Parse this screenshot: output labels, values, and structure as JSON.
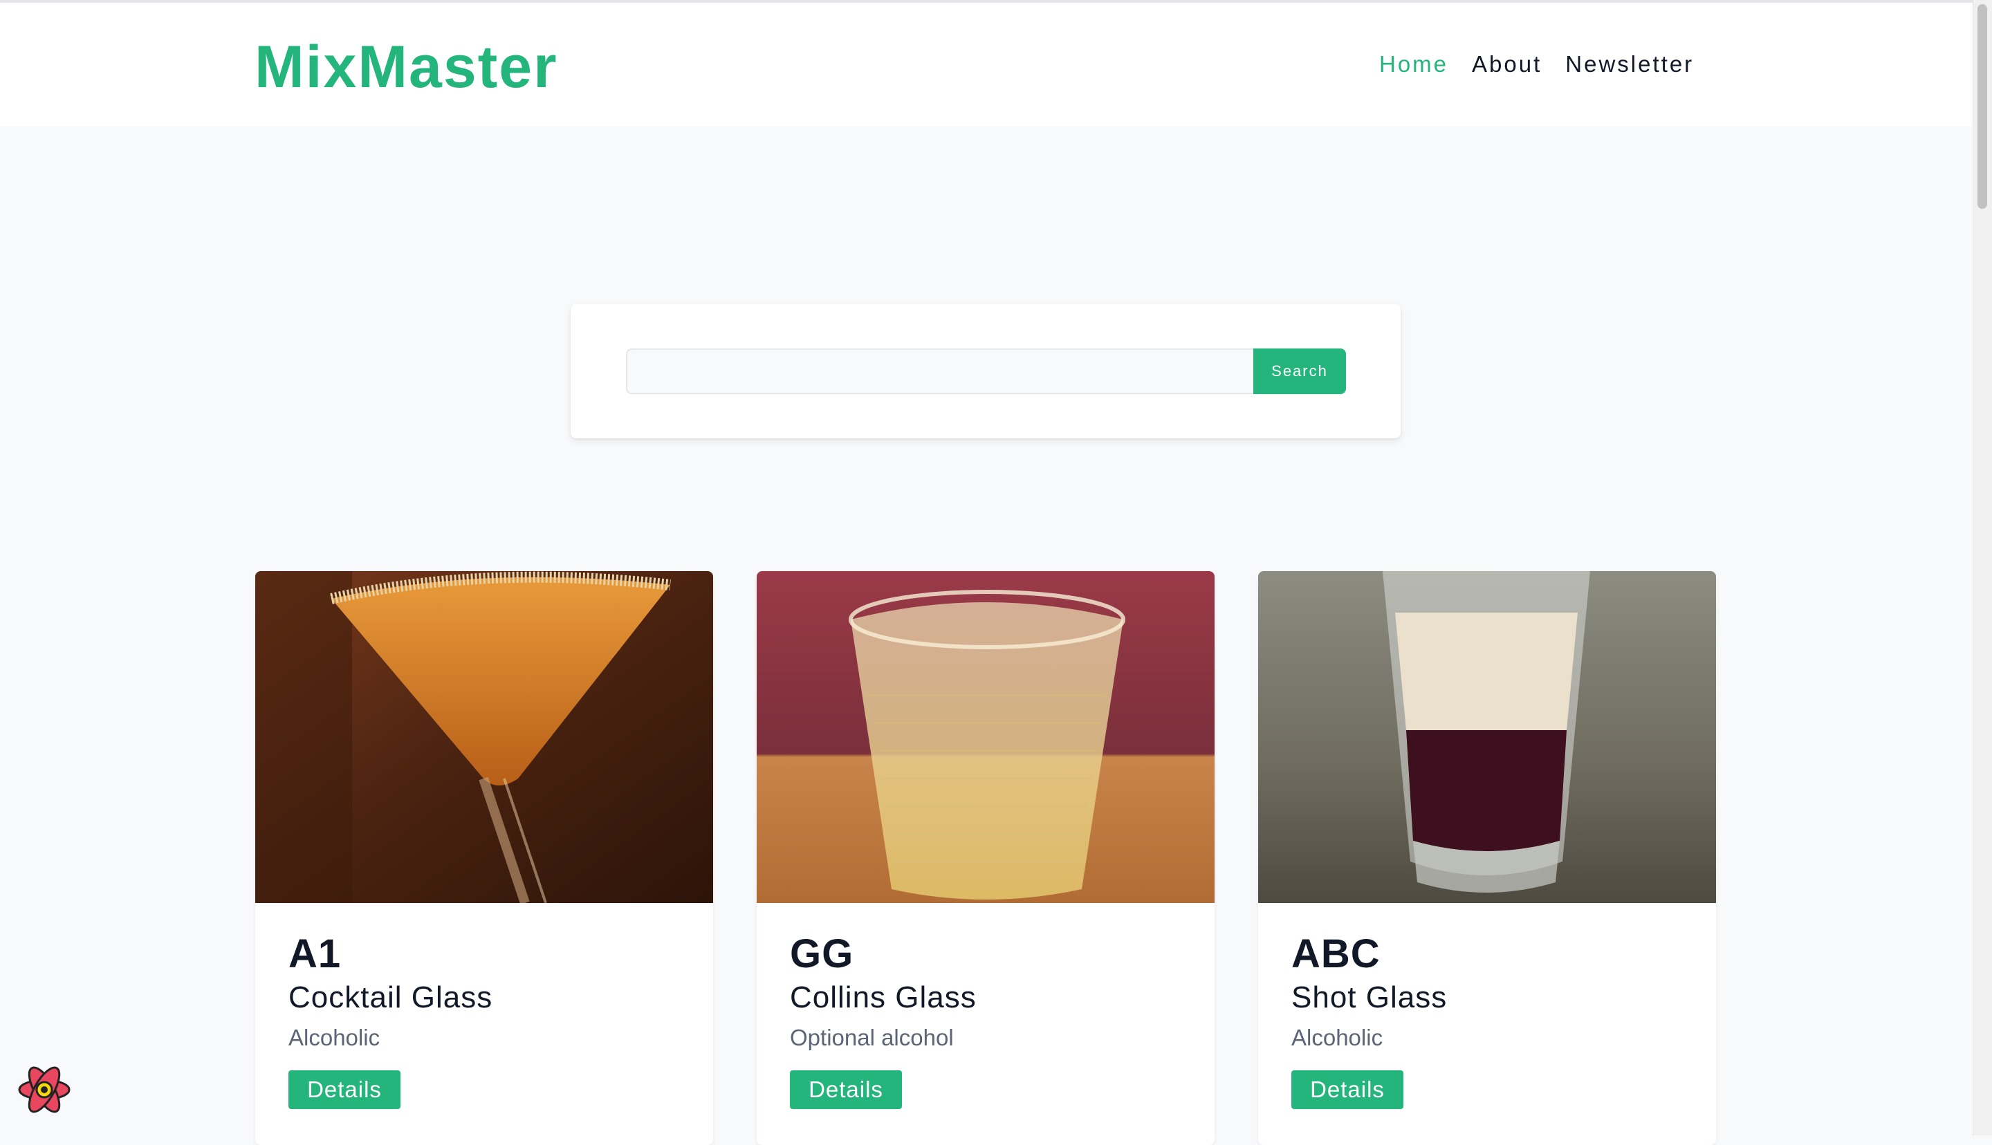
{
  "navbar": {
    "logo": "MixMaster",
    "links": [
      {
        "label": "Home",
        "active": true
      },
      {
        "label": "About",
        "active": false
      },
      {
        "label": "Newsletter",
        "active": false
      }
    ]
  },
  "search": {
    "value": "",
    "button_label": "Search"
  },
  "cocktails": [
    {
      "name": "A1",
      "glass": "Cocktail Glass",
      "info": "Alcoholic",
      "button": "Details",
      "image": "orange-cocktail-martini-glass"
    },
    {
      "name": "GG",
      "glass": "Collins Glass",
      "info": "Optional alcohol",
      "button": "Details",
      "image": "clear-drink-textured-glass"
    },
    {
      "name": "ABC",
      "glass": "Shot Glass",
      "info": "Alcoholic",
      "button": "Details",
      "image": "layered-shot-glass"
    }
  ],
  "colors": {
    "accent": "#24b57c",
    "text": "#111827",
    "muted": "#5b6576",
    "background": "#f8f9fb"
  },
  "icons": {
    "devtools": "react-devtools-icon"
  }
}
